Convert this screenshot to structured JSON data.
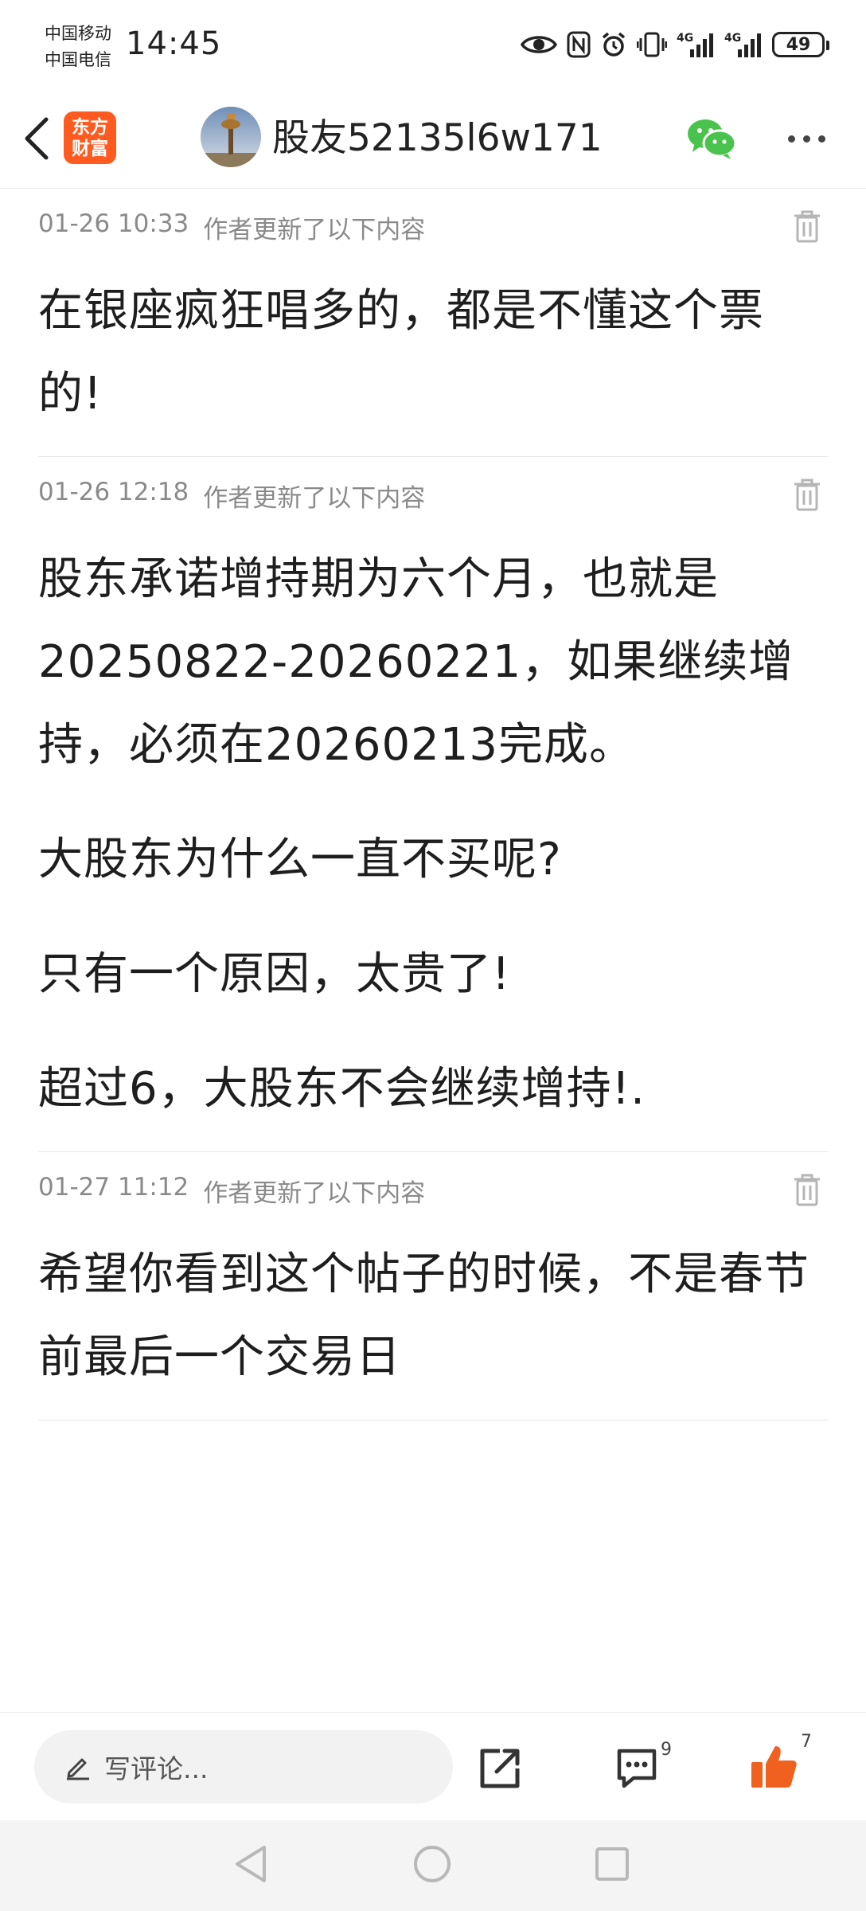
{
  "status_bar": {
    "carrier_1": "中国移动",
    "carrier_2": "中国电信",
    "time": "14:45",
    "signal_1_label": "4G",
    "signal_2_label": "4G",
    "battery": "49",
    "icons": [
      "eye-icon",
      "nfc-icon",
      "alarm-icon",
      "vibrate-icon",
      "signal-icon",
      "signal-icon",
      "battery-icon"
    ]
  },
  "header": {
    "logo_line_1": "东方",
    "logo_line_2": "财富",
    "username": "股友52135l6w171",
    "icons": [
      "back-arrow-icon",
      "avatar",
      "wechat-icon",
      "more-icon"
    ]
  },
  "updates": [
    {
      "time": "01-26 10:33",
      "label": "作者更新了以下内容",
      "paragraphs": [
        "在银座疯狂唱多的，都是不懂这个票的!"
      ]
    },
    {
      "time": "01-26 12:18",
      "label": "作者更新了以下内容",
      "paragraphs": [
        "股东承诺增持期为六个月，也就是20250822-20260221，如果继续增持，必须在20260213完成。",
        "大股东为什么一直不买呢?",
        "只有一个原因，太贵了!",
        "超过6，大股东不会继续增持!."
      ]
    },
    {
      "time": "01-27 11:12",
      "label": "作者更新了以下内容",
      "paragraphs": [
        "希望你看到这个帖子的时候，不是春节前最后一个交易日"
      ]
    }
  ],
  "action_bar": {
    "comment_placeholder": "写评论...",
    "comment_count": "9",
    "like_count": "7",
    "like_color": "#f0601e"
  },
  "colors": {
    "brand_orange": "#ff5a1f",
    "wechat_green": "#4ac34e",
    "meta_gray": "#8a8a8a"
  }
}
